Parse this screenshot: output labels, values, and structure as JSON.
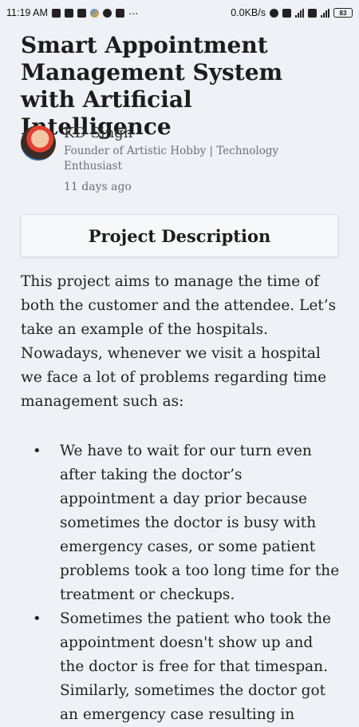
{
  "status_bar": {
    "time": "11:19 AM",
    "network_speed": "0.0KB/s",
    "battery": "83"
  },
  "article": {
    "title": "Smart Appointment Management System with Artificial Intelligence",
    "author": {
      "name": "KD Singh",
      "role": "Founder of Artistic Hobby | Technology Enthusiast",
      "posted": "11 days ago"
    },
    "section_title": "Project Description",
    "intro": "This project aims to manage the time of both the customer and the attendee. Let’s take an example of the hospitals. Nowadays, whenever we visit a hospital we face a lot of problems regarding time management such as:",
    "bullets": [
      "We have to wait for our turn even after taking the doctor’s appointment a day prior because sometimes the doctor is busy with emergency cases, or some patient problems took a too long time for the treatment or checkups.",
      "Sometimes the patient who took the appointment doesn't show up and the doctor is free for that timespan. Similarly, sometimes the doctor got an emergency case resulting in"
    ]
  }
}
